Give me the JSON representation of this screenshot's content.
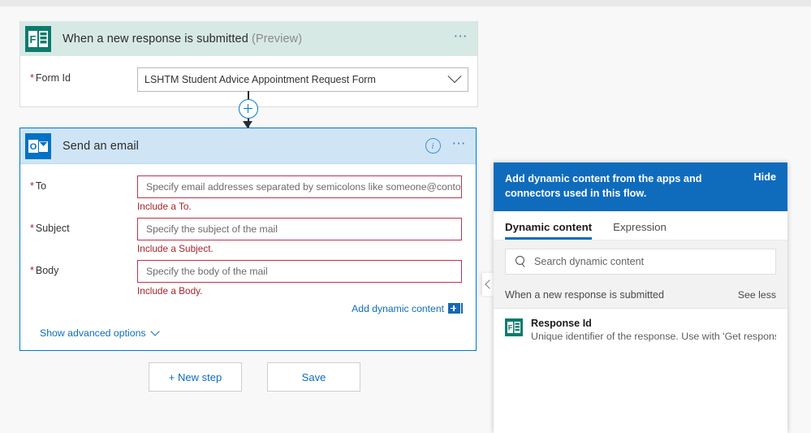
{
  "colors": {
    "forms_teal": "#0d7b6c",
    "outlook_blue": "#0072c6",
    "accent_blue": "#0f6cbd",
    "error_red": "#a4262c",
    "trigger_header": "#d7e9e5",
    "action_header": "#cfe5f6"
  },
  "trigger": {
    "icon": "microsoft-forms-icon",
    "title": "When a new response is submitted",
    "preview_tag": "(Preview)",
    "more_icon": "ellipsis-icon",
    "form_id": {
      "label": "Form Id",
      "required_marker": "*",
      "value": "LSHTM Student Advice Appointment Request Form",
      "chevron_icon": "chevron-down-icon"
    }
  },
  "connector": {
    "add_step_icon": "plus-circle-icon",
    "arrow_icon": "arrow-down-icon"
  },
  "action": {
    "icon": "outlook-icon",
    "title": "Send an email",
    "info_icon": "info-icon",
    "more_icon": "ellipsis-icon",
    "fields": [
      {
        "label": "To",
        "required_marker": "*",
        "placeholder": "Specify email addresses separated by semicolons like someone@contoso.com",
        "error": "Include a To."
      },
      {
        "label": "Subject",
        "required_marker": "*",
        "placeholder": "Specify the subject of the mail",
        "error": "Include a Subject."
      },
      {
        "label": "Body",
        "required_marker": "*",
        "placeholder": "Specify the body of the mail",
        "error": "Include a Body."
      }
    ],
    "add_dynamic_content": {
      "label": "Add dynamic content",
      "icon": "insert-dynamic-content-icon"
    },
    "advanced_options": {
      "label": "Show advanced options",
      "chevron_icon": "chevron-down-icon"
    }
  },
  "footer": {
    "new_step_label": "+ New step",
    "save_label": "Save"
  },
  "dynamic_panel": {
    "collapse_icon": "chevron-left-icon",
    "header_text": "Add dynamic content from the apps and connectors used in this flow.",
    "hide_label": "Hide",
    "tabs": [
      {
        "label": "Dynamic content",
        "active": true
      },
      {
        "label": "Expression",
        "active": false
      }
    ],
    "search": {
      "icon": "search-icon",
      "placeholder": "Search dynamic content"
    },
    "group": {
      "name": "When a new response is submitted",
      "toggle_label": "See less"
    },
    "items": [
      {
        "icon": "microsoft-forms-icon",
        "title": "Response Id",
        "description": "Unique identifier of the response. Use with 'Get response de…"
      }
    ]
  }
}
